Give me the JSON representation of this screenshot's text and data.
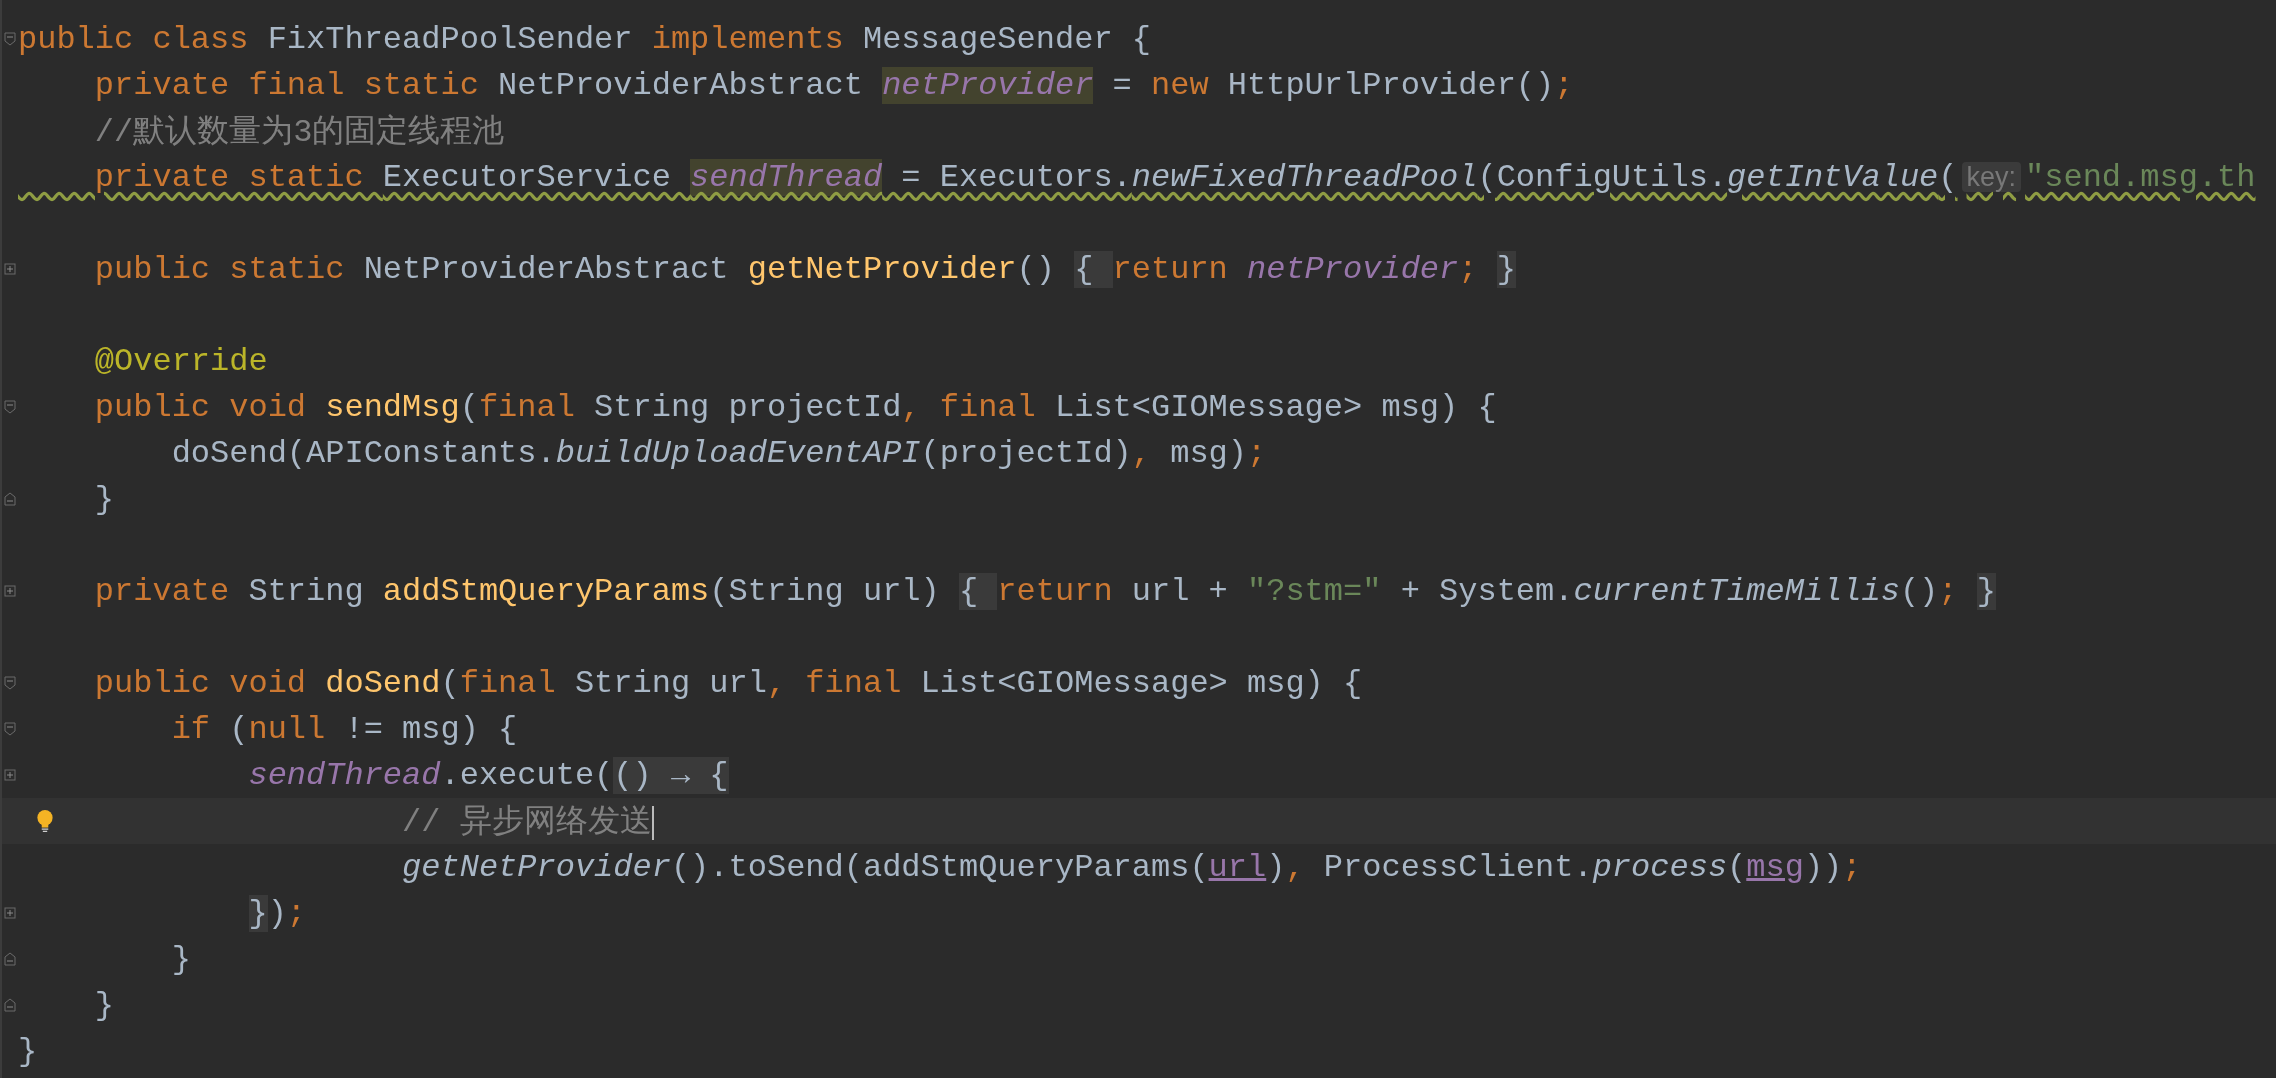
{
  "editor": {
    "lines": [
      {
        "fold": {
          "kind": "open"
        },
        "space_above": false,
        "current": false,
        "warning": false,
        "bulb": false,
        "tokens": [
          {
            "kind": "kw",
            "text": "public class "
          },
          {
            "kind": "plain",
            "text": "FixThreadPoolSender "
          },
          {
            "kind": "kw",
            "text": "implements "
          },
          {
            "kind": "plain",
            "text": "MessageSender {"
          }
        ]
      },
      {
        "space_above": false,
        "current": false,
        "warning": false,
        "bulb": false,
        "tokens": [
          {
            "kind": "kw",
            "text": "    private final static "
          },
          {
            "kind": "plain",
            "text": "NetProviderAbstract "
          },
          {
            "kind": "marked",
            "text": "netProvider"
          },
          {
            "kind": "plain",
            "text": " = "
          },
          {
            "kind": "kw",
            "text": "new "
          },
          {
            "kind": "plain",
            "text": "HttpUrlProvider()"
          },
          {
            "kind": "kw",
            "text": ";"
          }
        ]
      },
      {
        "space_above": false,
        "current": false,
        "warning": false,
        "bulb": false,
        "tokens": [
          {
            "kind": "comment",
            "text": "    //默认数量为3的固定线程池"
          }
        ]
      },
      {
        "space_above": false,
        "current": false,
        "warning": true,
        "bulb": false,
        "tokens": [
          {
            "kind": "kw",
            "text": "    private static "
          },
          {
            "kind": "plain",
            "text": "ExecutorService "
          },
          {
            "kind": "marked",
            "text": "sendThread"
          },
          {
            "kind": "plain",
            "text": " = Executors."
          },
          {
            "kind": "static",
            "text": "newFixedThreadPool"
          },
          {
            "kind": "plain",
            "text": "(ConfigUtils."
          },
          {
            "kind": "static",
            "text": "getIntValue"
          },
          {
            "kind": "plain",
            "text": "("
          },
          {
            "kind": "hint",
            "text": "key:"
          },
          {
            "kind": "str",
            "text": "\"send.msg.th"
          }
        ]
      },
      {
        "fold": {
          "kind": "collapsed"
        },
        "space_above": true,
        "current": false,
        "warning": false,
        "bulb": false,
        "tokens": [
          {
            "kind": "kw",
            "text": "    public static "
          },
          {
            "kind": "plain",
            "text": "NetProviderAbstract "
          },
          {
            "kind": "decl",
            "text": "getNetProvider"
          },
          {
            "kind": "plain",
            "text": "() "
          },
          {
            "kind": "fold",
            "text": "{ "
          },
          {
            "kind": "kw",
            "text": "return "
          },
          {
            "kind": "field",
            "text": "netProvider"
          },
          {
            "kind": "kw",
            "text": "; "
          },
          {
            "kind": "fold",
            "text": "}"
          }
        ]
      },
      {
        "space_above": true,
        "current": false,
        "warning": false,
        "bulb": false,
        "tokens": [
          {
            "kind": "annot",
            "text": "    @Override"
          }
        ]
      },
      {
        "fold": {
          "kind": "open"
        },
        "space_above": false,
        "current": false,
        "warning": false,
        "bulb": false,
        "tokens": [
          {
            "kind": "kw",
            "text": "    public void "
          },
          {
            "kind": "decl",
            "text": "sendMsg"
          },
          {
            "kind": "plain",
            "text": "("
          },
          {
            "kind": "kw",
            "text": "final "
          },
          {
            "kind": "plain",
            "text": "String projectId"
          },
          {
            "kind": "kw",
            "text": ", final "
          },
          {
            "kind": "plain",
            "text": "List<GIOMessage> msg) {"
          }
        ]
      },
      {
        "space_above": false,
        "current": false,
        "warning": false,
        "bulb": false,
        "tokens": [
          {
            "kind": "plain",
            "text": "        doSend(APIConstants."
          },
          {
            "kind": "static",
            "text": "buildUploadEventAPI"
          },
          {
            "kind": "plain",
            "text": "(projectId)"
          },
          {
            "kind": "kw",
            "text": ", "
          },
          {
            "kind": "plain",
            "text": "msg)"
          },
          {
            "kind": "kw",
            "text": ";"
          }
        ]
      },
      {
        "fold": {
          "kind": "close"
        },
        "space_above": false,
        "current": false,
        "warning": false,
        "bulb": false,
        "tokens": [
          {
            "kind": "plain",
            "text": "    }"
          }
        ]
      },
      {
        "fold": {
          "kind": "collapsed"
        },
        "space_above": true,
        "current": false,
        "warning": false,
        "bulb": false,
        "tokens": [
          {
            "kind": "kw",
            "text": "    private "
          },
          {
            "kind": "plain",
            "text": "String "
          },
          {
            "kind": "decl",
            "text": "addStmQueryParams"
          },
          {
            "kind": "plain",
            "text": "(String url) "
          },
          {
            "kind": "fold",
            "text": "{ "
          },
          {
            "kind": "kw",
            "text": "return "
          },
          {
            "kind": "plain",
            "text": "url + "
          },
          {
            "kind": "str",
            "text": "\"?stm=\""
          },
          {
            "kind": "plain",
            "text": " + System."
          },
          {
            "kind": "static",
            "text": "currentTimeMillis"
          },
          {
            "kind": "plain",
            "text": "()"
          },
          {
            "kind": "kw",
            "text": "; "
          },
          {
            "kind": "fold",
            "text": "}"
          }
        ]
      },
      {
        "fold": {
          "kind": "open"
        },
        "space_above": true,
        "current": false,
        "warning": false,
        "bulb": false,
        "tokens": [
          {
            "kind": "kw",
            "text": "    public void "
          },
          {
            "kind": "decl",
            "text": "doSend"
          },
          {
            "kind": "plain",
            "text": "("
          },
          {
            "kind": "kw",
            "text": "final "
          },
          {
            "kind": "plain",
            "text": "String url"
          },
          {
            "kind": "kw",
            "text": ", final "
          },
          {
            "kind": "plain",
            "text": "List<GIOMessage> msg) {"
          }
        ]
      },
      {
        "fold": {
          "kind": "open"
        },
        "space_above": false,
        "current": false,
        "warning": false,
        "bulb": false,
        "tokens": [
          {
            "kind": "kw",
            "text": "        if "
          },
          {
            "kind": "plain",
            "text": "("
          },
          {
            "kind": "kw",
            "text": "null "
          },
          {
            "kind": "plain",
            "text": "!= msg) {"
          }
        ]
      },
      {
        "fold": {
          "kind": "collapsed"
        },
        "space_above": false,
        "current": false,
        "warning": false,
        "bulb": false,
        "tokens": [
          {
            "kind": "field",
            "text": "            sendThread"
          },
          {
            "kind": "plain",
            "text": ".execute("
          },
          {
            "kind": "fold",
            "text": "() → {"
          }
        ]
      },
      {
        "space_above": false,
        "current": true,
        "warning": false,
        "bulb": true,
        "tokens": [
          {
            "kind": "comment",
            "text": "                    // 异步网络发送"
          }
        ]
      },
      {
        "space_above": false,
        "current": false,
        "warning": false,
        "bulb": false,
        "tokens": [
          {
            "kind": "static",
            "text": "                    getNetProvider"
          },
          {
            "kind": "plain",
            "text": "().toSend(addStmQueryParams("
          },
          {
            "kind": "captured",
            "text": "url"
          },
          {
            "kind": "plain",
            "text": ")"
          },
          {
            "kind": "kw",
            "text": ", "
          },
          {
            "kind": "plain",
            "text": "ProcessClient."
          },
          {
            "kind": "static",
            "text": "process"
          },
          {
            "kind": "plain",
            "text": "("
          },
          {
            "kind": "captured",
            "text": "msg"
          },
          {
            "kind": "plain",
            "text": "))"
          },
          {
            "kind": "kw",
            "text": ";"
          }
        ]
      },
      {
        "fold": {
          "kind": "collapsed"
        },
        "space_above": false,
        "current": false,
        "warning": false,
        "bulb": false,
        "tokens": [
          {
            "kind": "foldtail",
            "text": "            }"
          },
          {
            "kind": "plain",
            "text": ")"
          },
          {
            "kind": "kw",
            "text": ";"
          }
        ]
      },
      {
        "fold": {
          "kind": "close"
        },
        "space_above": false,
        "current": false,
        "warning": false,
        "bulb": false,
        "tokens": [
          {
            "kind": "plain",
            "text": "        }"
          }
        ]
      },
      {
        "fold": {
          "kind": "close"
        },
        "space_above": false,
        "current": false,
        "warning": false,
        "bulb": false,
        "tokens": [
          {
            "kind": "plain",
            "text": "    }"
          }
        ]
      },
      {
        "space_above": false,
        "current": false,
        "warning": false,
        "bulb": false,
        "tokens": [
          {
            "kind": "plain",
            "text": "}"
          }
        ]
      }
    ]
  }
}
